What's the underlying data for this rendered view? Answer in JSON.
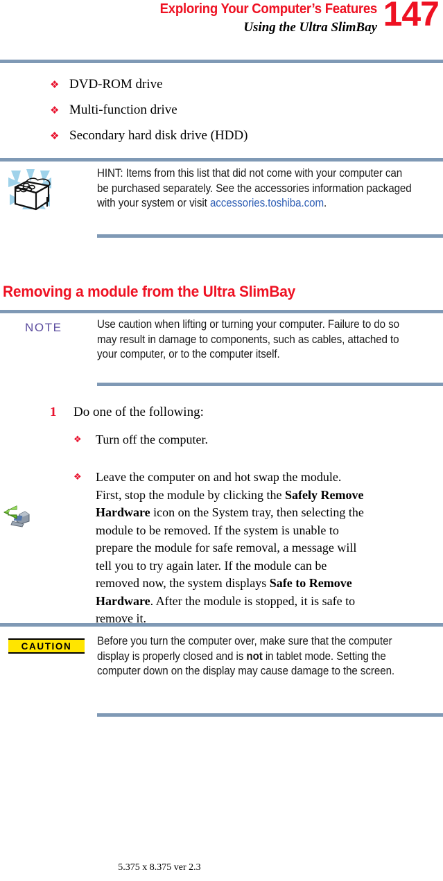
{
  "header": {
    "title": "Exploring Your Computer’s Features",
    "subtitle": "Using the Ultra SlimBay",
    "page_number": "147"
  },
  "module_list": {
    "items": [
      {
        "bullet": "❖",
        "label": "DVD-ROM drive"
      },
      {
        "bullet": "❖",
        "label": "Multi-function drive"
      },
      {
        "bullet": "❖",
        "label": "Secondary hard disk drive (HDD)"
      }
    ]
  },
  "hint_callout": {
    "icon_name": "treasure-chest-icon",
    "text_before_link": "HINT: Items from this list that did not come with your computer can be purchased separately. See the accessories information packaged with your system or visit ",
    "link_text": "accessories.toshiba.com",
    "text_after_link": "."
  },
  "section": {
    "heading": "Removing a module from the Ultra SlimBay"
  },
  "note_callout": {
    "label": "NOTE",
    "text": "Use caution when lifting or turning your computer. Failure to do so may result in damage to components, such as cables, attached to your computer, or to the computer itself."
  },
  "step": {
    "number": "1",
    "text": "Do one of the following:",
    "options": [
      {
        "bullet": "❖",
        "segments": [
          {
            "text": "Turn off the computer.",
            "bold": false
          }
        ]
      },
      {
        "bullet": "❖",
        "icon_name": "safely-remove-hardware-icon",
        "segments": [
          {
            "text": "Leave the computer on and hot swap the module. First, stop the module by clicking the ",
            "bold": false
          },
          {
            "text": "Safely Remove Hardware",
            "bold": true
          },
          {
            "text": " icon on the System tray, then selecting the module to be removed. If the system is unable to prepare the module for safe removal, a message will tell you to try again later. If the module can be removed now, the system displays ",
            "bold": false
          },
          {
            "text": "Safe to Remove Hardware",
            "bold": true
          },
          {
            "text": ". After the module is stopped, it is safe to remove it.",
            "bold": false
          }
        ]
      }
    ]
  },
  "caution_callout": {
    "label": "CAUTION",
    "segments": [
      {
        "text": "Before you turn the computer over, make sure that the computer display is properly closed and is ",
        "bold": false
      },
      {
        "text": "not",
        "bold": true
      },
      {
        "text": " in tablet mode. Setting the computer down on the display may cause damage to the screen.",
        "bold": false
      }
    ]
  },
  "footer": {
    "text": "5.375 x 8.375 ver 2.3"
  },
  "colors": {
    "accent_red": "#ee1122",
    "bullet_red": "#e8112d",
    "rule_blue": "#7f99b5",
    "note_purple": "#5b4c9e",
    "caution_yellow": "#ffe500",
    "link_blue": "#2f5fb5"
  }
}
